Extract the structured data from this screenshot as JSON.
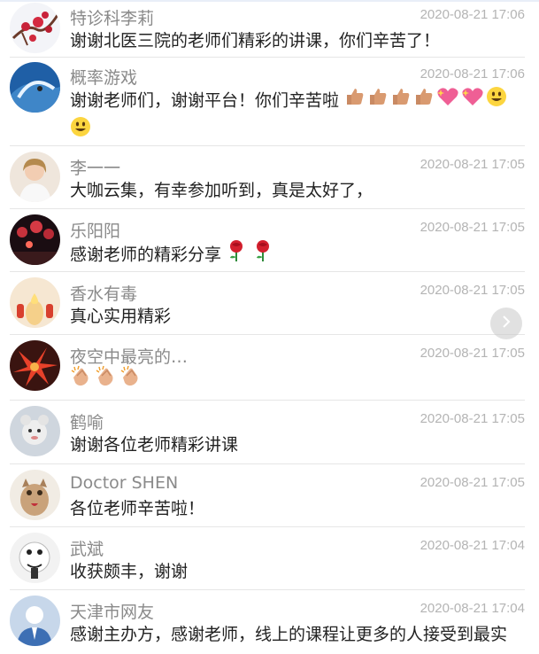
{
  "comments": [
    {
      "name": "特诊科李莉",
      "time": "2020-08-21 17:06",
      "text": "谢谢北医三院的老师们精彩的讲课，你们辛苦了！",
      "emojis": []
    },
    {
      "name": "概率游戏",
      "time": "2020-08-21 17:06",
      "text": "谢谢老师们，谢谢平台！你们辛苦啦",
      "emojis": [
        "thumbs-up",
        "thumbs-up",
        "thumbs-up",
        "thumbs-up",
        "sparkling-heart",
        "sparkling-heart",
        "grinning-face",
        "grinning-face"
      ]
    },
    {
      "name": "李一一",
      "time": "2020-08-21 17:05",
      "text": "大咖云集，有幸参加听到，真是太好了，",
      "emojis": []
    },
    {
      "name": "乐阳阳",
      "time": "2020-08-21 17:05",
      "text": "感谢老师的精彩分享",
      "emojis": [
        "rose",
        "rose"
      ]
    },
    {
      "name": "香水有毒",
      "time": "2020-08-21 17:05",
      "text": "真心实用精彩",
      "emojis": []
    },
    {
      "name": "夜空中最亮的…",
      "time": "2020-08-21 17:05",
      "text": "",
      "emojis": [
        "clapping-hands",
        "clapping-hands",
        "clapping-hands"
      ]
    },
    {
      "name": "鹤喻",
      "time": "2020-08-21 17:05",
      "text": "谢谢各位老师精彩讲课",
      "emojis": []
    },
    {
      "name": "Doctor SHEN",
      "time": "2020-08-21 17:05",
      "text": "各位老师辛苦啦！",
      "emojis": []
    },
    {
      "name": "武斌",
      "time": "2020-08-21 17:04",
      "text": "收获颇丰，谢谢",
      "emojis": []
    },
    {
      "name": "天津市网友",
      "time": "2020-08-21 17:04",
      "text": "感谢主办方，感谢老师，线上的课程让更多的人接受到最实",
      "emojis": []
    }
  ],
  "colors": {
    "name": "#8a8a8a",
    "time": "#b4b4b4",
    "text": "#222222",
    "divider": "#e6e6e6"
  },
  "icons": {
    "next": "chevron-right-icon"
  }
}
